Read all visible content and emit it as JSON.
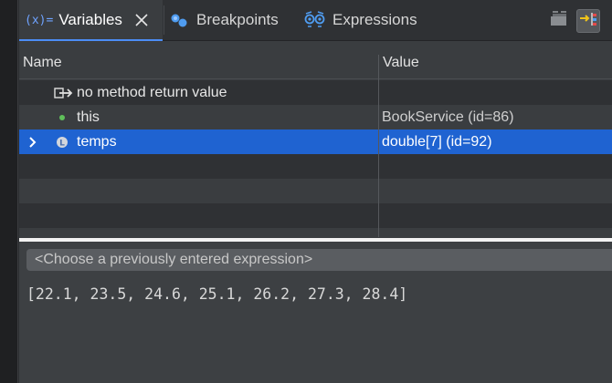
{
  "tabs": [
    {
      "label": "Variables",
      "icon": "variables-icon",
      "active": true
    },
    {
      "label": "Breakpoints",
      "icon": "breakpoints-icon",
      "active": false
    },
    {
      "label": "Expressions",
      "icon": "expressions-icon",
      "active": false
    }
  ],
  "variables_icon_text": "(x)=",
  "toolbar": {
    "buttons": [
      "collapse-all-icon",
      "show-logical-structure-icon"
    ]
  },
  "table": {
    "headers": {
      "name": "Name",
      "value": "Value"
    },
    "rows": [
      {
        "name": "no method return value",
        "value": "",
        "icon": "method-return-icon",
        "expandable": false,
        "selected": false
      },
      {
        "name": "this",
        "value": "BookService  (id=86)",
        "icon": "field-dot-icon",
        "expandable": false,
        "selected": false
      },
      {
        "name": "temps",
        "value": "double[7]  (id=92)",
        "icon": "local-variable-icon",
        "expandable": true,
        "selected": true
      }
    ]
  },
  "detail": {
    "placeholder": "<Choose a previously entered expression>",
    "result": "[22.1, 23.5, 24.6, 25.1, 26.2, 27.3, 28.4]"
  },
  "colors": {
    "selection": "#1f63d1",
    "accent": "#4c8df6"
  }
}
